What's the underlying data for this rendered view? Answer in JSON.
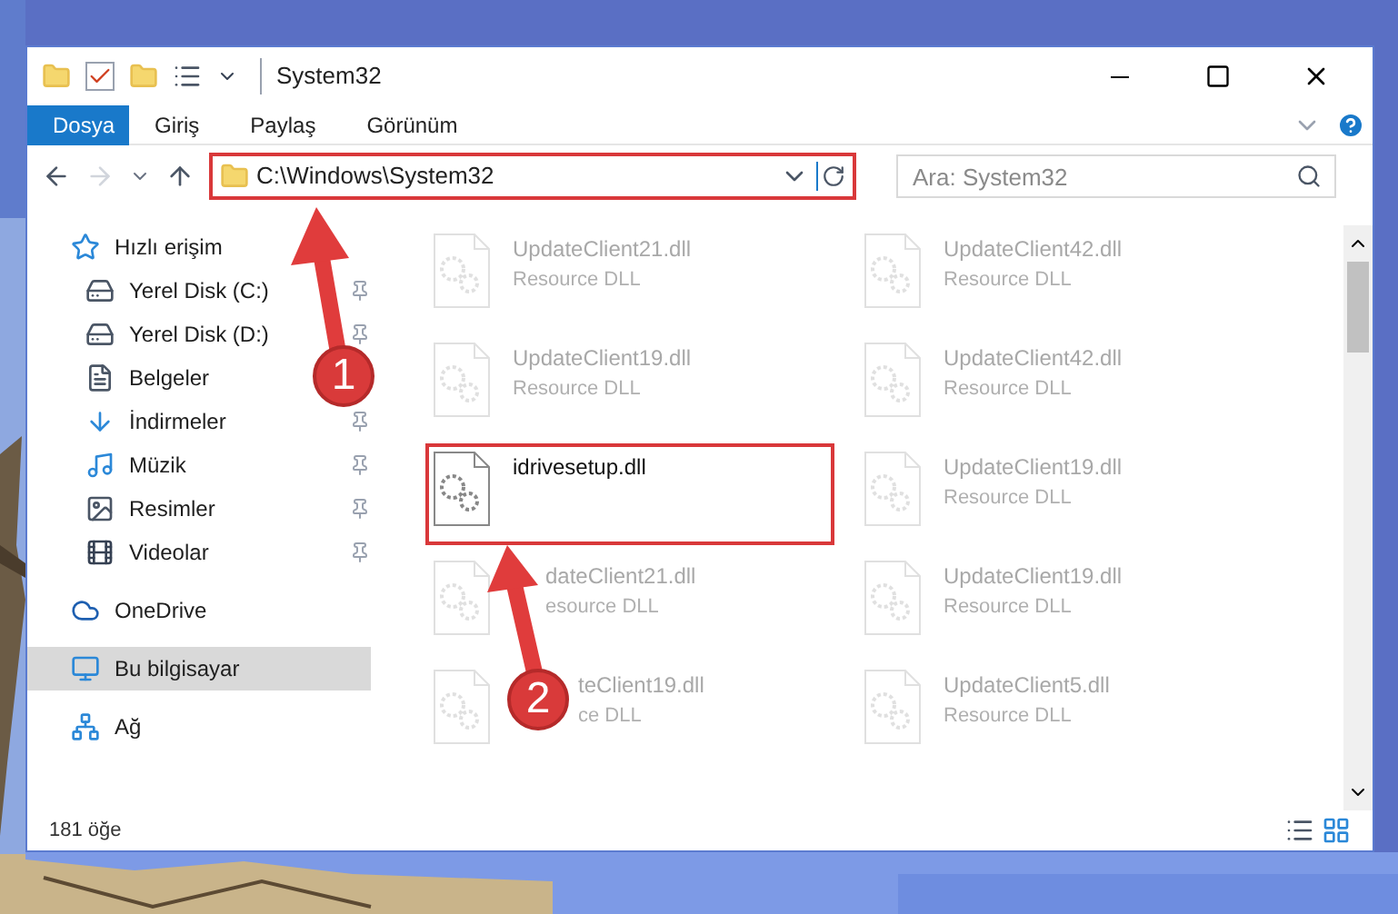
{
  "window": {
    "title": "System32"
  },
  "ribbon_tabs": [
    {
      "label": "Dosya",
      "selected": true
    },
    {
      "label": "Giriş",
      "selected": false
    },
    {
      "label": "Paylaş",
      "selected": false
    },
    {
      "label": "Görünüm",
      "selected": false
    }
  ],
  "address_bar": {
    "path": "C:\\Windows\\System32",
    "highlighted": true
  },
  "search": {
    "placeholder": "Ara: System32"
  },
  "sidebar": {
    "items": [
      {
        "label": "Hızlı erişim",
        "selected": false,
        "children": [
          {
            "label": "Yerel Disk (C:)",
            "pinned": true,
            "selected": false
          },
          {
            "label": "Yerel Disk (D:)",
            "pinned": true,
            "selected": false
          },
          {
            "label": "Belgeler",
            "pinned": false,
            "selected": false
          },
          {
            "label": "İndirmeler",
            "pinned": true,
            "selected": false
          },
          {
            "label": "Müzik",
            "pinned": true,
            "selected": false
          },
          {
            "label": "Resimler",
            "pinned": true,
            "selected": false
          },
          {
            "label": "Videolar",
            "pinned": true,
            "selected": false
          }
        ]
      },
      {
        "label": "OneDrive",
        "selected": false
      },
      {
        "label": "Bu bilgisayar",
        "selected": true
      },
      {
        "label": "Ağ",
        "selected": false
      }
    ]
  },
  "files": [
    {
      "name": "UpdateClient21.dll",
      "type": "Resource DLL",
      "faded": true,
      "highlighted": false
    },
    {
      "name": "UpdateClient42.dll",
      "type": "Resource DLL",
      "faded": true,
      "highlighted": false
    },
    {
      "name": "UpdateClient19.dll",
      "type": "Resource DLL",
      "faded": true,
      "highlighted": false
    },
    {
      "name": "UpdateClient42.dll",
      "type": "Resource DLL",
      "faded": true,
      "highlighted": false
    },
    {
      "name": "idrivesetup.dll",
      "faded": false,
      "highlighted": true
    },
    {
      "name": "UpdateClient19.dll",
      "type": "Resource DLL",
      "faded": true,
      "highlighted": false
    },
    {
      "name": "dateClient21.dll",
      "type": "esource DLL",
      "faded": true,
      "highlighted": false
    },
    {
      "name": "UpdateClient19.dll",
      "type": "Resource DLL",
      "faded": true,
      "highlighted": false
    },
    {
      "name": "teClient19.dll",
      "type": "ce DLL",
      "faded": true,
      "highlighted": false
    },
    {
      "name": "UpdateClient5.dll",
      "type": "Resource DLL",
      "faded": true,
      "highlighted": false
    }
  ],
  "status_bar": {
    "item_count": "181 öğe"
  },
  "annotations": [
    {
      "number": "1"
    },
    {
      "number": "2"
    }
  ]
}
